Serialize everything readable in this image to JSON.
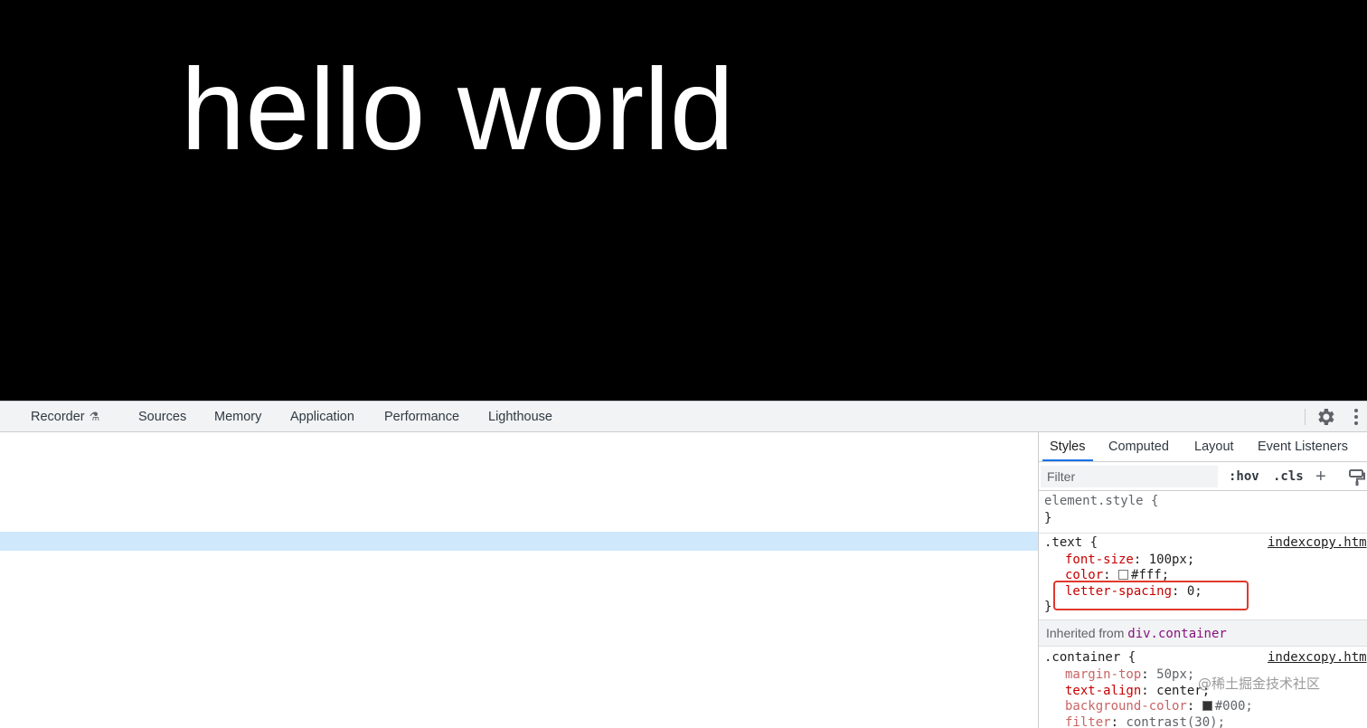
{
  "page": {
    "heading": "hello world",
    "background": "#000000",
    "text_color": "#ffffff"
  },
  "devtools": {
    "main_tabs": [
      {
        "label": "Recorder",
        "icon": "flask-icon"
      },
      {
        "label": "Sources"
      },
      {
        "label": "Memory"
      },
      {
        "label": "Application"
      },
      {
        "label": "Performance"
      },
      {
        "label": "Lighthouse"
      }
    ],
    "settings_icon": "gear-icon",
    "more_icon": "kebab-icon",
    "sidebar_tabs": [
      {
        "label": "Styles",
        "active": true
      },
      {
        "label": "Computed"
      },
      {
        "label": "Layout"
      },
      {
        "label": "Event Listeners"
      }
    ],
    "filter": {
      "placeholder": "Filter",
      "hov": ":hov",
      "cls": ".cls",
      "add": "+"
    },
    "rules": {
      "element_style": {
        "selector": "element.style {",
        "close": "}"
      },
      "text": {
        "selector": ".text {",
        "source": "indexcopy.htm",
        "props": [
          {
            "name": "font-size",
            "value": "100px;"
          },
          {
            "name": "color",
            "value": "#fff;",
            "swatch": "#ffffff"
          },
          {
            "name": "letter-spacing",
            "value": "0;"
          }
        ],
        "close": "}"
      },
      "inherited": {
        "label": "Inherited from",
        "link": "div.container"
      },
      "container": {
        "selector": ".container {",
        "source": "indexcopy.htm",
        "props": [
          {
            "name": "margin-top",
            "value": "50px;",
            "dim": true
          },
          {
            "name": "text-align",
            "value": "center;"
          },
          {
            "name": "background-color",
            "value": "#000;",
            "swatch": "#333333",
            "dim": true
          },
          {
            "name": "filter",
            "value": "contrast(30);"
          }
        ]
      }
    },
    "highlight_color": "#e0392b",
    "watermark": "@稀土掘金技术社区"
  }
}
